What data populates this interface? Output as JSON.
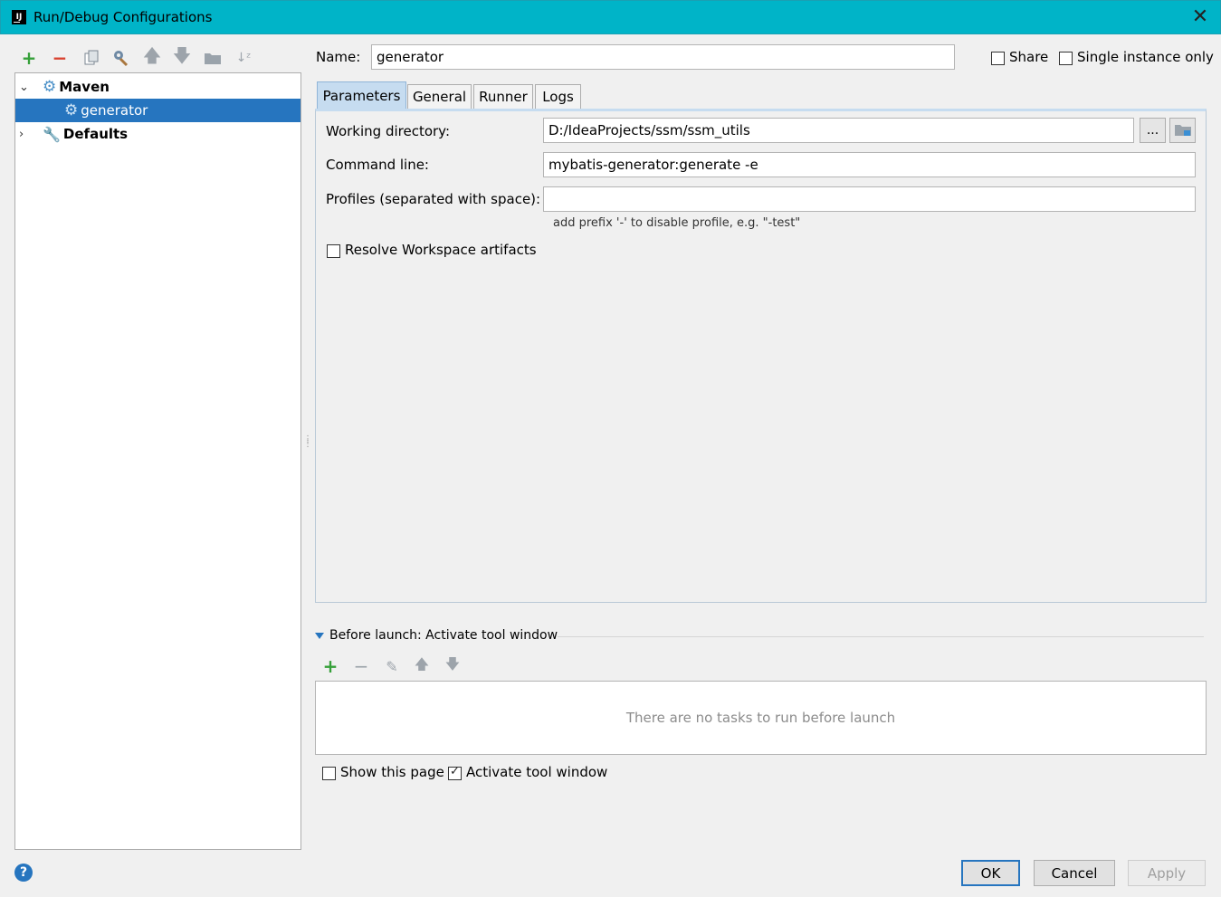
{
  "window": {
    "title": "Run/Debug Configurations"
  },
  "toolbar": {
    "icons": [
      "add-icon",
      "remove-icon",
      "copy-icon",
      "edit-defaults-icon",
      "move-up-icon",
      "move-down-icon",
      "folder-icon",
      "sort-icon"
    ]
  },
  "tree": {
    "items": [
      {
        "label": "Maven",
        "expanded": true,
        "icon": "maven-gear-icon"
      },
      {
        "label": "generator",
        "selected": true,
        "icon": "gear-icon"
      },
      {
        "label": "Defaults",
        "expanded": false,
        "icon": "wrench-icon"
      }
    ]
  },
  "config": {
    "name_label": "Name:",
    "name_value": "generator",
    "share_label": "Share",
    "share_checked": false,
    "single_instance_label": "Single instance only",
    "single_instance_checked": false
  },
  "tabs": [
    {
      "label": "Parameters",
      "active": true
    },
    {
      "label": "General",
      "active": false
    },
    {
      "label": "Runner",
      "active": false
    },
    {
      "label": "Logs",
      "active": false
    }
  ],
  "parameters": {
    "working_dir_label": "Working directory:",
    "working_dir_value": "D:/IdeaProjects/ssm/ssm_utils",
    "browse_label": "...",
    "command_line_label": "Command line:",
    "command_line_value": "mybatis-generator:generate -e",
    "profiles_label": "Profiles (separated with space):",
    "profiles_value": "",
    "profiles_hint": "add prefix '-' to disable profile, e.g. \"-test\"",
    "resolve_label": "Resolve Workspace artifacts",
    "resolve_checked": false
  },
  "before_launch": {
    "title": "Before launch: Activate tool window",
    "empty_text": "There are no tasks to run before launch",
    "show_page_label": "Show this page",
    "show_page_checked": false,
    "activate_label": "Activate tool window",
    "activate_checked": true
  },
  "buttons": {
    "ok": "OK",
    "cancel": "Cancel",
    "apply": "Apply",
    "help": "?"
  },
  "colors": {
    "titlebar": "#00b4c8",
    "selection": "#2675bf",
    "add_green": "#36a03a",
    "remove_red": "#d9412f"
  }
}
